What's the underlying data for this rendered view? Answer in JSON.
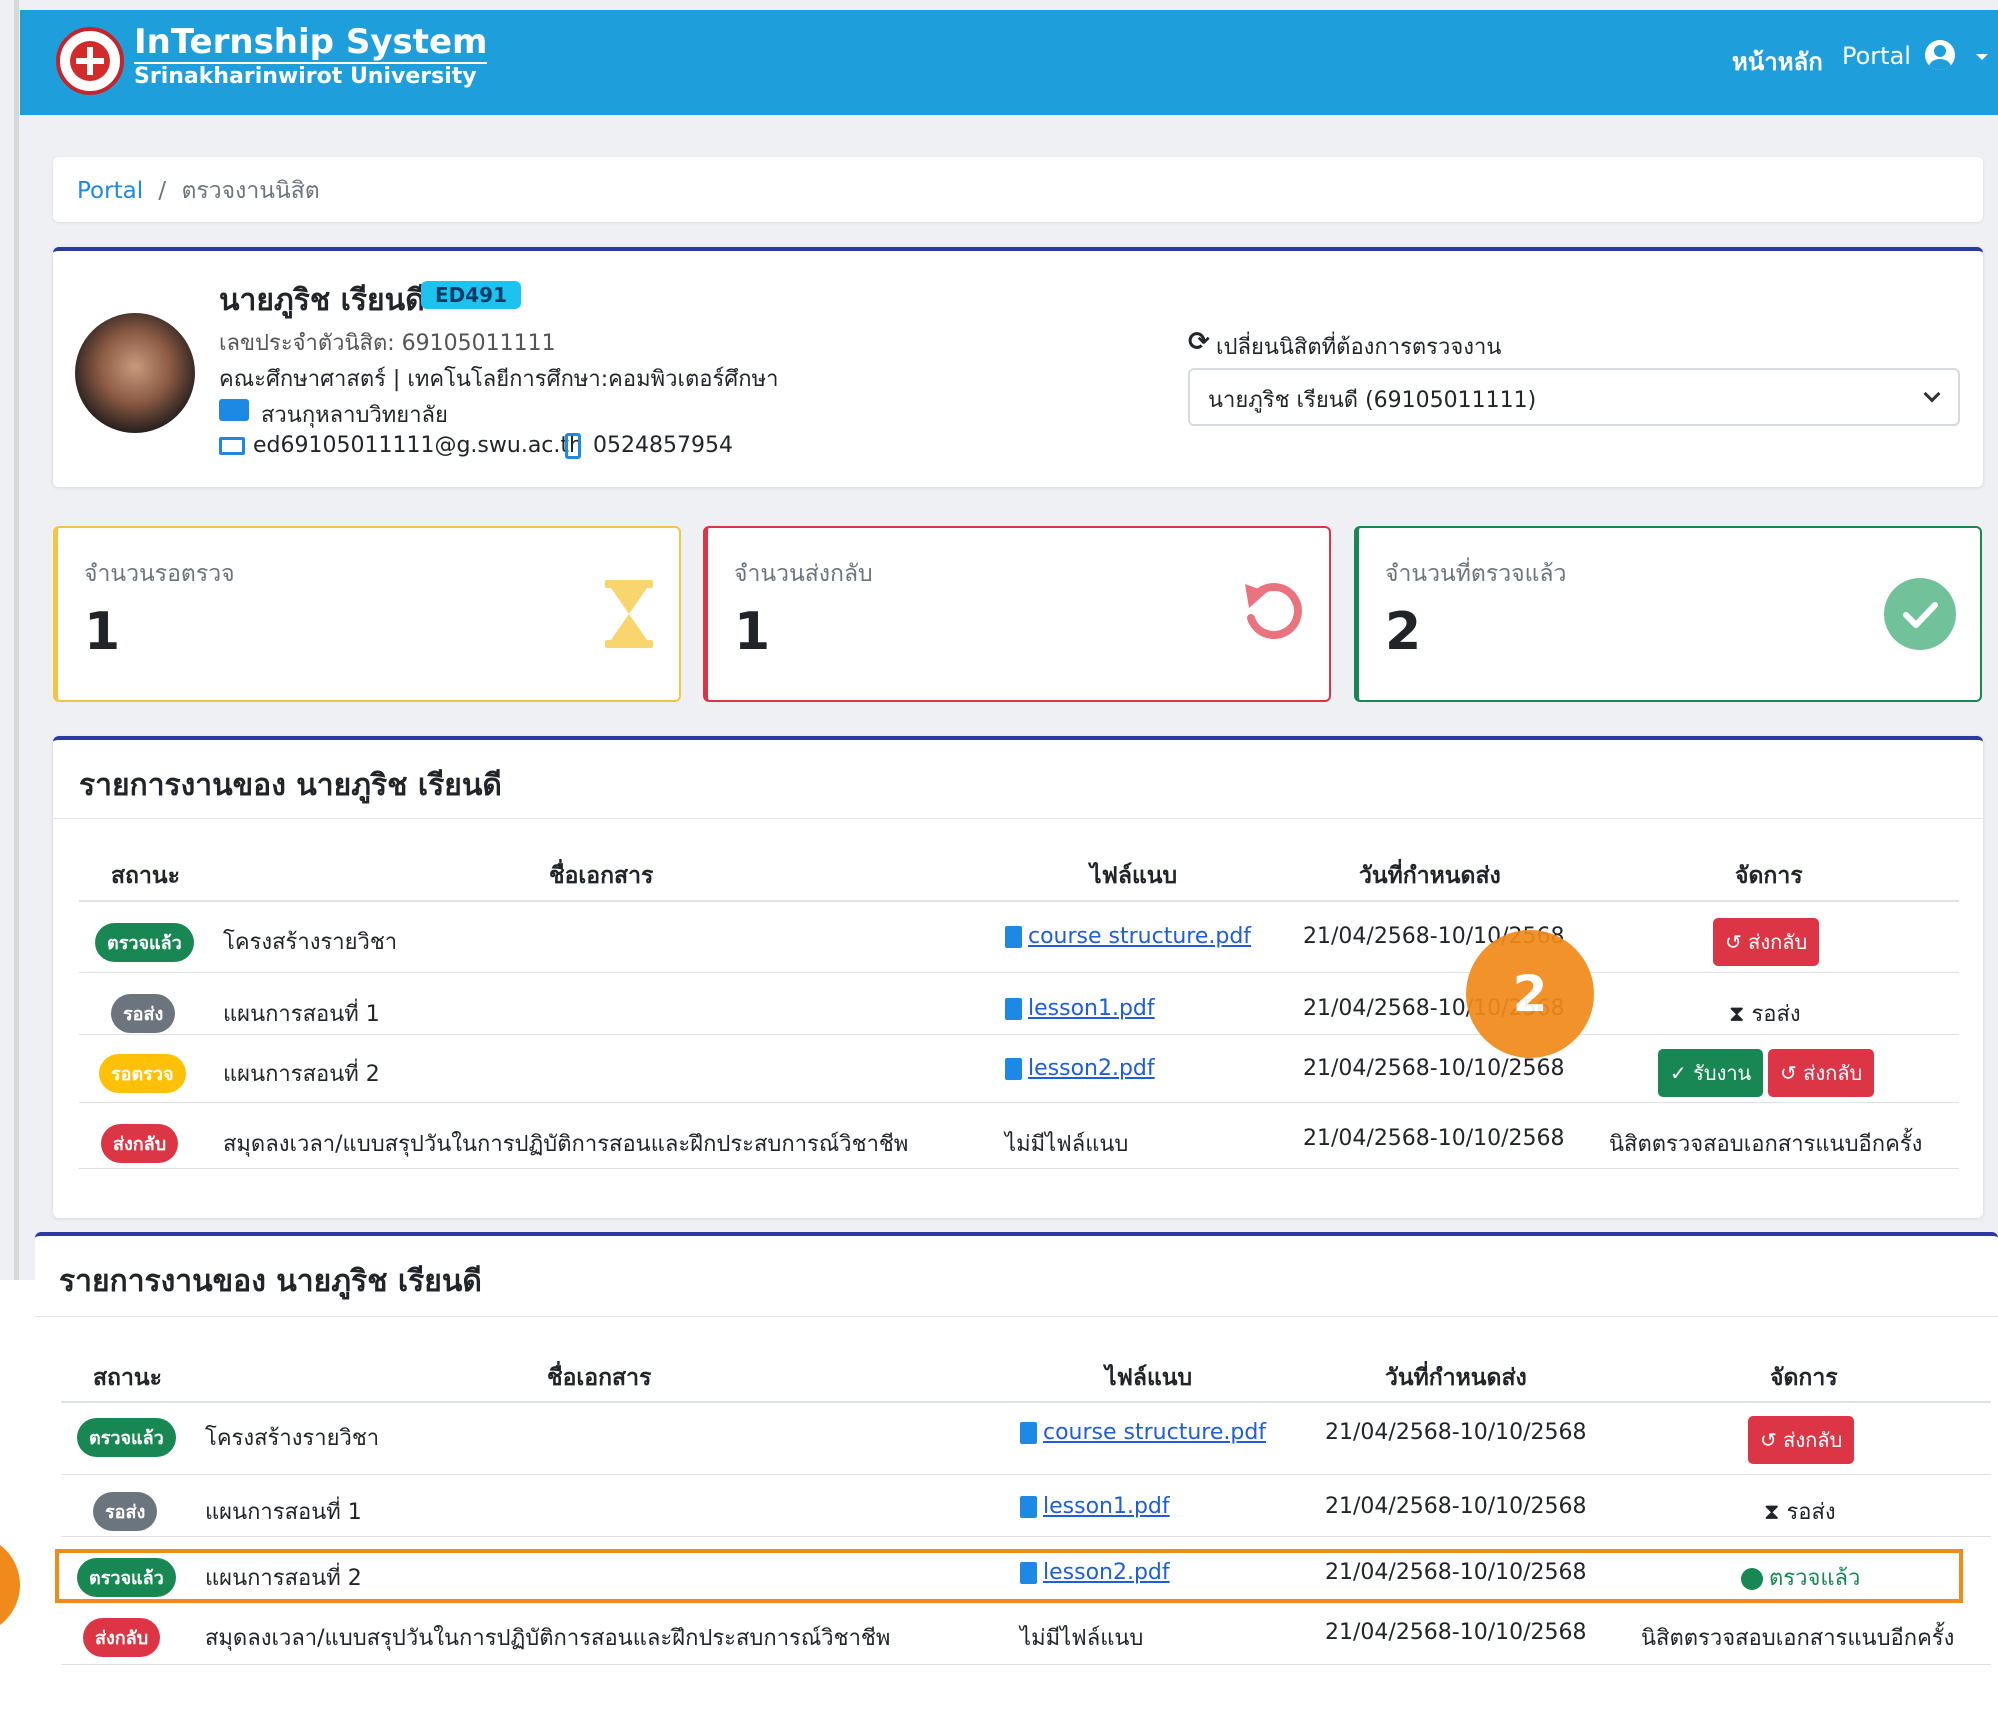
{
  "app": {
    "title": "InTernship System",
    "subtitle": "Srinakharinwirot University"
  },
  "nav": {
    "home": "หน้าหลัก",
    "portal": "Portal"
  },
  "breadcrumb": {
    "root": "Portal",
    "sep": "/",
    "current": "ตรวจงานนิสิต"
  },
  "student": {
    "name": "นายภูริช เรียนดี",
    "badge": "ED491",
    "id_line": "เลขประจำตัวนิสิต: 69105011111",
    "faculty": "คณะศึกษาศาสตร์ | เทคโนโลยีการศึกษา:คอมพิวเตอร์ศึกษา",
    "school": "สวนกุหลาบวิทยาลัย",
    "email": "ed69105011111@g.swu.ac.th",
    "phone": "0524857954"
  },
  "switcher": {
    "icon": "refresh-icon",
    "label": "เปลี่ยนนิสิตที่ต้องการตรวจงาน",
    "selected": "นายภูริช เรียนดี (69105011111)"
  },
  "stats": {
    "waiting": {
      "label": "จำนวนรอตรวจ",
      "value": "1",
      "color": "#f5c542",
      "icon": "hourglass-icon"
    },
    "returned": {
      "label": "จำนวนส่งกลับ",
      "value": "1",
      "color": "#dc3545",
      "icon": "undo-icon"
    },
    "checked": {
      "label": "จำนวนที่ตรวจแล้ว",
      "value": "2",
      "color": "#198754",
      "icon": "check-circle-icon"
    }
  },
  "columns": {
    "status": "สถานะ",
    "doc": "ชื่อเอกสาร",
    "file": "ไฟล์แนบ",
    "due": "วันที่กำหนดส่ง",
    "manage": "จัดการ"
  },
  "labels": {
    "return": "ส่งกลับ",
    "accept": "รับงาน",
    "pending": "รอส่ง",
    "checked": "ตรวจแล้ว",
    "recheck": "นิสิตตรวจสอบเอกสารแนบอีกครั้ง"
  },
  "table1": {
    "title": "รายการงานของ นายภูริช เรียนดี",
    "rows": [
      {
        "status": "ตรวจแล้ว",
        "doc": "โครงสร้างรายวิชา",
        "file": "course structure.pdf",
        "due": "21/04/2568-10/10/2568"
      },
      {
        "status": "รอส่ง",
        "doc": "แผนการสอนที่ 1",
        "file": "lesson1.pdf",
        "due": "21/04/2568-10/10/2568"
      },
      {
        "status": "รอตรวจ",
        "doc": "แผนการสอนที่ 2",
        "file": "lesson2.pdf",
        "due": "21/04/2568-10/10/2568"
      },
      {
        "status": "ส่งกลับ",
        "doc": "สมุดลงเวลา/แบบสรุปวันในการปฏิบัติการสอนและฝึกประสบการณ์วิชาชีพ",
        "file": "ไม่มีไฟล์แนบ",
        "due": "21/04/2568-10/10/2568"
      }
    ]
  },
  "table2": {
    "title": "รายการงานของ นายภูริช เรียนดี",
    "rows": [
      {
        "status": "ตรวจแล้ว",
        "doc": "โครงสร้างรายวิชา",
        "file": "course structure.pdf",
        "due": "21/04/2568-10/10/2568"
      },
      {
        "status": "รอส่ง",
        "doc": "แผนการสอนที่ 1",
        "file": "lesson1.pdf",
        "due": "21/04/2568-10/10/2568"
      },
      {
        "status": "ตรวจแล้ว",
        "doc": "แผนการสอนที่ 2",
        "file": "lesson2.pdf",
        "due": "21/04/2568-10/10/2568"
      },
      {
        "status": "ส่งกลับ",
        "doc": "สมุดลงเวลา/แบบสรุปวันในการปฏิบัติการสอนและฝึกประสบการณ์วิชาชีพ",
        "file": "ไม่มีไฟล์แนบ",
        "due": "21/04/2568-10/10/2568"
      }
    ]
  },
  "step_marker": "2",
  "colors": {
    "navbar": "#1e9fdc",
    "accent_border": "#2b3a9e",
    "highlight": "#f18a1c"
  }
}
